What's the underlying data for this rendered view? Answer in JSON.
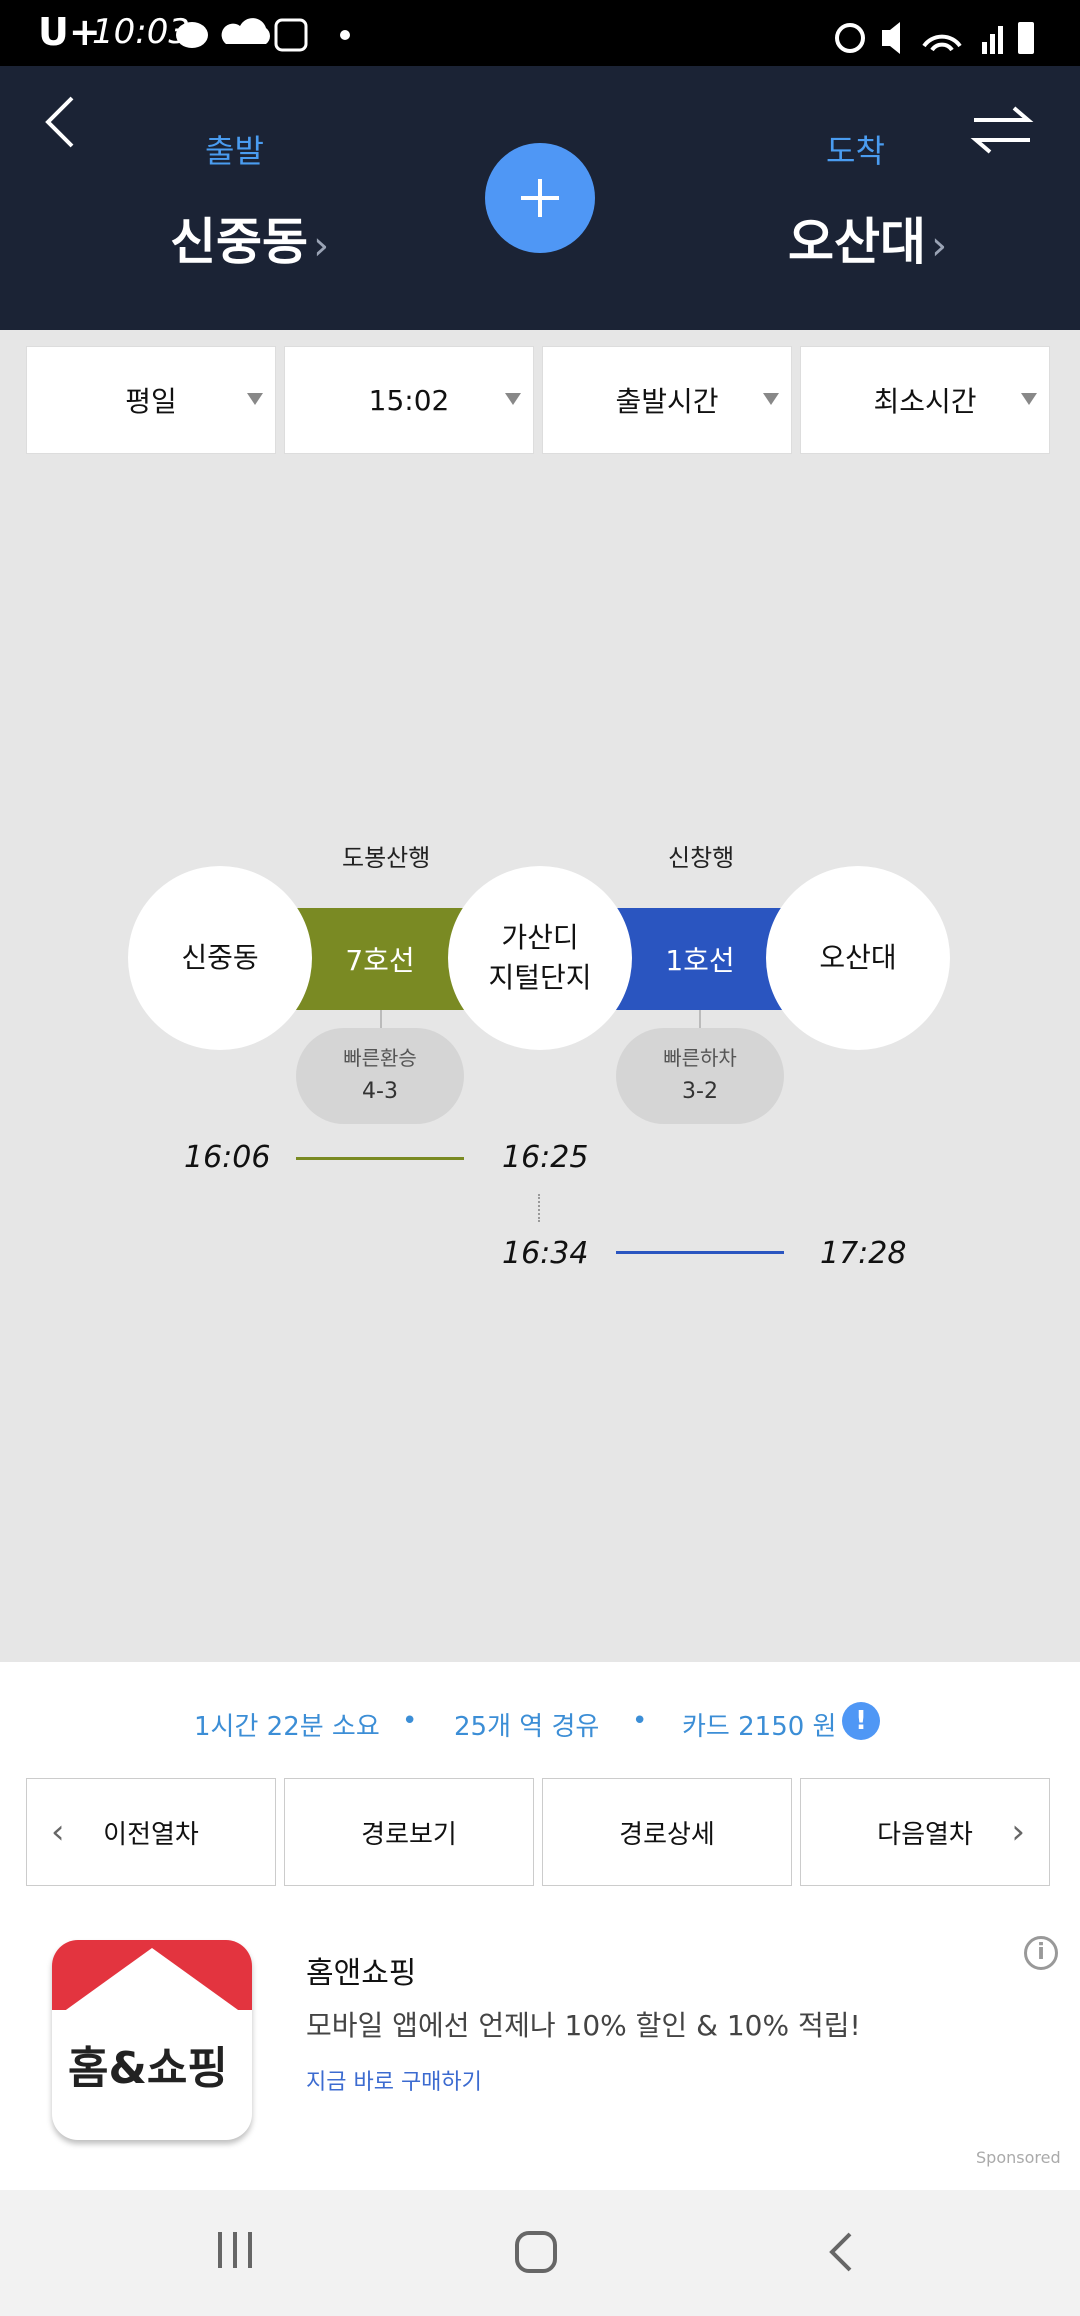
{
  "status": {
    "carrier": "U+",
    "time": "10:03"
  },
  "header": {
    "departure_label": "출발",
    "departure_station": "신중동",
    "arrival_label": "도착",
    "arrival_station": "오산대"
  },
  "filters": [
    {
      "label": "평일"
    },
    {
      "label": "15:02"
    },
    {
      "label": "출발시간"
    },
    {
      "label": "최소시간"
    }
  ],
  "route": {
    "stations": [
      "신중동",
      "가산디\n지털단지",
      "오산대"
    ],
    "segments": [
      {
        "line": "7호선",
        "direction": "도봉산행",
        "color": "#7a8a23",
        "fast_label": "빠른환승",
        "fast_value": "4-3",
        "depart": "16:06",
        "arrive": "16:25"
      },
      {
        "line": "1호선",
        "direction": "신창행",
        "color": "#2a55c0",
        "fast_label": "빠른하차",
        "fast_value": "3-2",
        "depart": "16:34",
        "arrive": "17:28"
      }
    ]
  },
  "summary": {
    "duration": "1시간 22분 소요",
    "stations": "25개 역 경유",
    "fare": "카드 2150 원"
  },
  "buttons": {
    "prev": "이전열차",
    "route_view": "경로보기",
    "route_detail": "경로상세",
    "next": "다음열차"
  },
  "ad": {
    "logo_text": "홈&쇼핑",
    "title": "홈앤쇼핑",
    "desc": "모바일 앱에선 언제나 10% 할인 & 10% 적립!",
    "cta": "지금 바로 구매하기",
    "sponsored": "Sponsored"
  },
  "colors": {
    "header_bg": "#1b2335",
    "accent": "#4f97f5",
    "line7": "#7a8a23",
    "line1": "#2a55c0"
  }
}
